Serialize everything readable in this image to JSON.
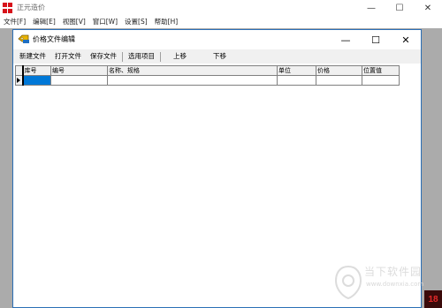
{
  "app": {
    "title": "正元造价",
    "controls": {
      "minimize": "—",
      "maximize": "☐",
      "close": "✕"
    },
    "brand_color": "#d7121a"
  },
  "menu": [
    {
      "label": "文件[F]"
    },
    {
      "label": "编辑[E]"
    },
    {
      "label": "视图[V]"
    },
    {
      "label": "窗口[W]"
    },
    {
      "label": "设置[S]"
    },
    {
      "label": "帮助[H]"
    }
  ],
  "child": {
    "title": "价格文件编辑",
    "controls": {
      "minimize": "—",
      "maximize": "☐",
      "close": "✕"
    },
    "border_color": "#2b6fb6"
  },
  "toolbar": {
    "new_file": "新建文件",
    "open_file": "打开文件",
    "save_file": "保存文件",
    "select_items": "选用项目",
    "move_up": "上移",
    "move_down": "下移"
  },
  "grid": {
    "columns": [
      "库号",
      "编号",
      "名称、规格",
      "单位",
      "价格",
      "位置值"
    ],
    "rows": [
      [
        "",
        "",
        "",
        "",
        "",
        ""
      ]
    ],
    "selection_color": "#0078d7"
  },
  "watermark": {
    "text": "当下软件园",
    "url": "www.downxia.com",
    "badge": "18"
  }
}
